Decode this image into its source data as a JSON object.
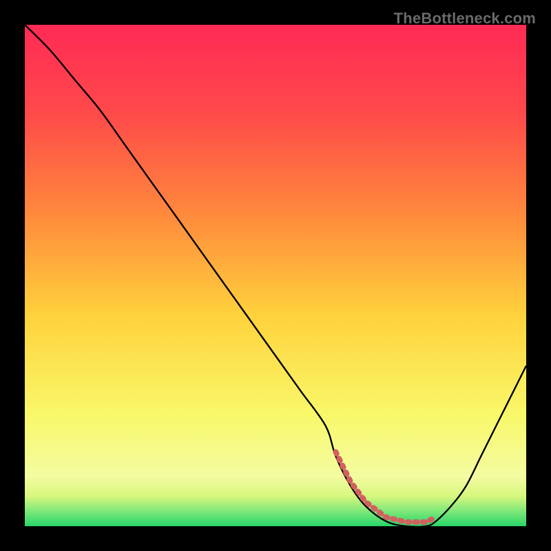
{
  "watermark": "TheBottleneck.com",
  "chart_data": {
    "type": "line",
    "title": "",
    "xlabel": "",
    "ylabel": "",
    "xlim": [
      0,
      100
    ],
    "ylim": [
      0,
      100
    ],
    "grid": false,
    "legend": false,
    "series": [
      {
        "name": "bottleneck-curve",
        "x": [
          0,
          5,
          10,
          15,
          20,
          25,
          30,
          35,
          40,
          45,
          50,
          55,
          60,
          62,
          65,
          68,
          72,
          76,
          80,
          82,
          85,
          88,
          91,
          94,
          97,
          100
        ],
        "values": [
          100,
          95,
          89,
          83,
          76,
          69,
          62,
          55,
          48,
          41,
          34,
          27,
          20,
          14,
          8,
          4,
          1,
          0,
          0,
          1,
          4,
          8,
          14,
          20,
          26,
          32
        ]
      }
    ],
    "highlight": {
      "name": "optimal-range",
      "x_start": 62,
      "x_end": 82,
      "color": "#d35f5f"
    },
    "gradient": {
      "top": "#ff2a55",
      "upper_mid": "#ff6a3c",
      "mid": "#ffd23c",
      "lower_mid": "#f7f56a",
      "bottom_band": "#2ed86a"
    }
  }
}
